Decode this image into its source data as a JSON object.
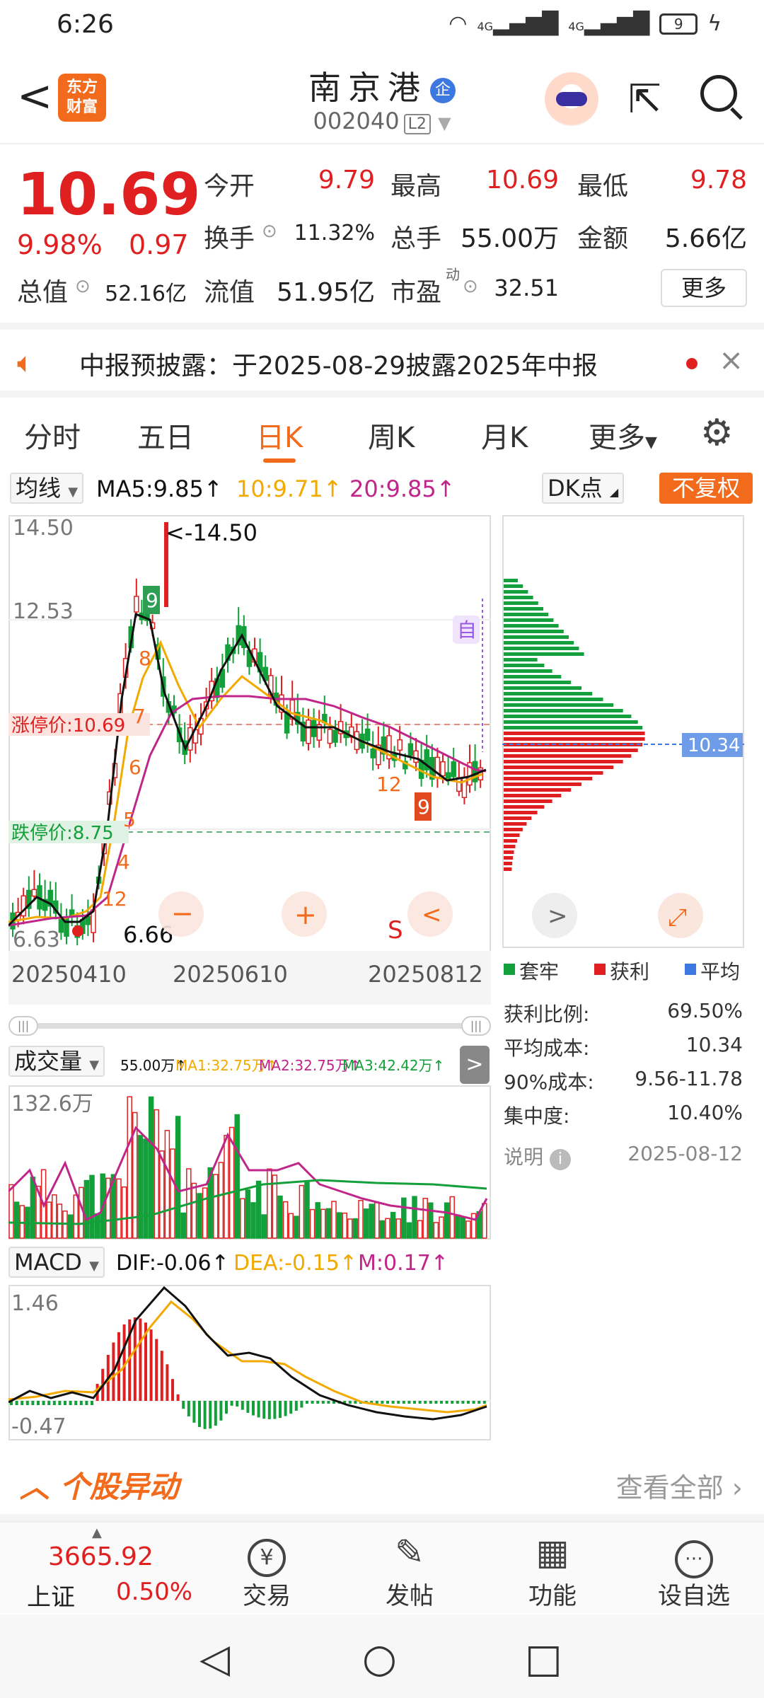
{
  "status_bar": {
    "time": "6:26",
    "signal1": "4G",
    "signal2": "4G",
    "battery": "9"
  },
  "header": {
    "back_glyph": "<",
    "logo_line1": "东方",
    "logo_line2": "财富",
    "stock_name": "南京港",
    "qi_badge": "企",
    "stock_code": "002040",
    "level_badge": "L2"
  },
  "quote": {
    "price": "10.69",
    "change_pct": "9.98%",
    "change_amt": "0.97",
    "open_label": "今开",
    "open": "9.79",
    "high_label": "最高",
    "high": "10.69",
    "low_label": "最低",
    "low": "9.78",
    "turnover_label": "换手",
    "turnover": "11.32%",
    "volume_label": "总手",
    "volume": "55.00万",
    "amount_label": "金额",
    "amount": "5.66亿",
    "mcap_label": "总值",
    "mcap": "52.16亿",
    "float_label": "流值",
    "float_mcap": "51.95亿",
    "pe_label": "市盈",
    "pe_sup": "动",
    "pe": "32.51",
    "more_label": "更多"
  },
  "notice": {
    "text": "中报预披露：于2025-08-29披露2025年中报",
    "close_glyph": "×"
  },
  "tabs": [
    {
      "label": "分时"
    },
    {
      "label": "五日"
    },
    {
      "label": "日K"
    },
    {
      "label": "周K"
    },
    {
      "label": "月K"
    },
    {
      "label": "更多"
    }
  ],
  "ma_row": {
    "dropdown": "均线",
    "ma5": "MA5:9.85↑",
    "ma10": "10:9.71↑",
    "ma20": "20:9.85↑",
    "dk": "DK点",
    "adjust": "不复权"
  },
  "colors": {
    "up": "#e02020",
    "down": "#13a03a",
    "accent": "#f26a1b",
    "ma5": "#111111",
    "ma10": "#f2a900",
    "ma20": "#c0268a",
    "avg_cost": "#3c78e0"
  },
  "kline": {
    "y_top": "14.50",
    "y_mid": "12.53",
    "y_low": "6.63",
    "max_label": "<-14.50",
    "min_label": "6.66",
    "limit_up_label": "涨停价:10.69",
    "limit_down_label": "跌停价:8.75",
    "dates": [
      "20250410",
      "20250610",
      "20250812"
    ],
    "s_marker": "S",
    "zi_marker": "自",
    "signal_nums": [
      "9",
      "8",
      "7",
      "6",
      "5",
      "4",
      "12",
      "12",
      "9"
    ],
    "btn_minus": "−",
    "btn_plus": "+",
    "btn_left": "<",
    "btn_right": ">"
  },
  "chip": {
    "cost_tag": "10.34",
    "legend": [
      {
        "label": "套牢",
        "color": "#13a03a"
      },
      {
        "label": "获利",
        "color": "#e02020"
      },
      {
        "label": "平均",
        "color": "#3c78e0"
      }
    ],
    "stats": [
      {
        "label": "获利比例:",
        "value": "69.50%"
      },
      {
        "label": "平均成本:",
        "value": "10.34"
      },
      {
        "label": "90%成本:",
        "value": "9.56-11.78"
      },
      {
        "label": "集中度:",
        "value": "10.40%"
      }
    ],
    "note_label": "说明",
    "note_date": "2025-08-12"
  },
  "volume": {
    "dropdown": "成交量",
    "v": "55.00万↑",
    "ma1": "MA1:32.75万↑",
    "ma2": "MA2:32.75万↑",
    "ma3": "MA3:42.42万↑",
    "y_top": "132.6万"
  },
  "macd": {
    "dropdown": "MACD",
    "dif": "DIF:-0.06↑",
    "dea": "DEA:-0.15↑",
    "m": "M:0.17↑",
    "y_top": "1.46",
    "y_low": "-0.47"
  },
  "alert": {
    "title": "个股异动",
    "view_all": "查看全部"
  },
  "bottom_nav": {
    "index_value": "3665.92",
    "index_name": "上证",
    "index_change": "0.50%",
    "items": [
      {
        "label": "交易",
        "icon": "¥"
      },
      {
        "label": "发帖",
        "icon": "✎"
      },
      {
        "label": "功能",
        "icon": "▦"
      },
      {
        "label": "设自选",
        "icon": "⋯"
      }
    ]
  }
}
